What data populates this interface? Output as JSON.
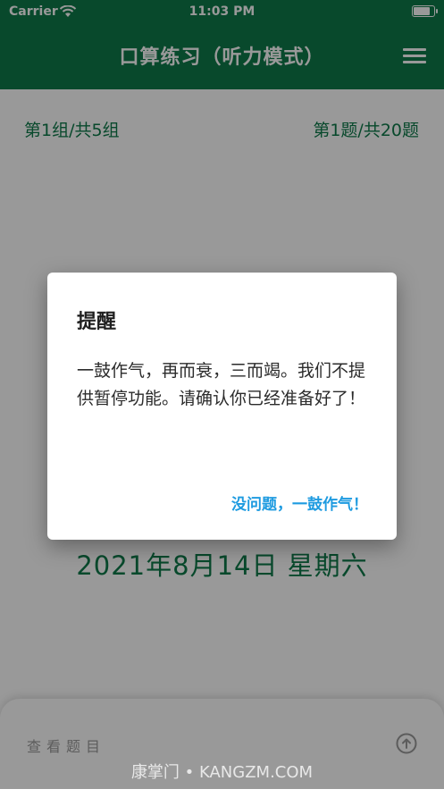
{
  "status_bar": {
    "carrier": "Carrier",
    "time": "11:03 PM"
  },
  "nav": {
    "title": "口算练习（听力模式）"
  },
  "progress": {
    "group": "第1组/共5组",
    "question": "第1题/共20题"
  },
  "date_text": "2021年8月14日   星期六",
  "bottom": {
    "view_questions": "查看题目"
  },
  "dialog": {
    "title": "提醒",
    "message": "一鼓作气，再而衰，三而竭。我们不提供暂停功能。请确认你已经准备好了！",
    "confirm_label": "没问题，一鼓作气！"
  },
  "watermark": "康掌门 • KANGZM.COM",
  "colors": {
    "primary": "#0e7a4a",
    "accent": "#1e9be0"
  }
}
